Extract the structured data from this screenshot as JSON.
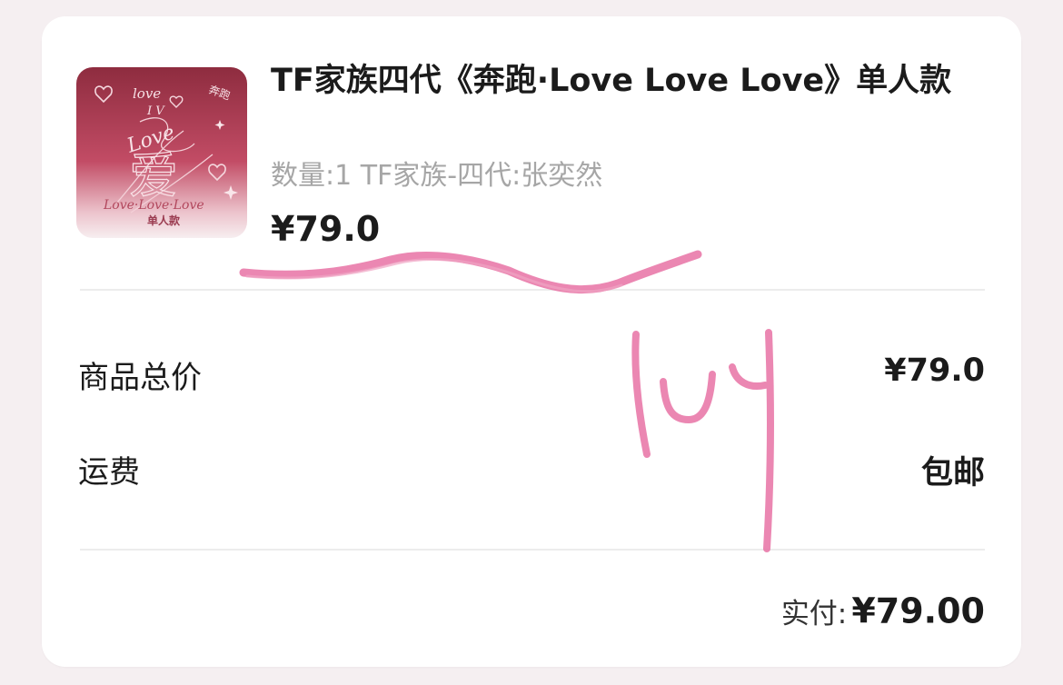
{
  "product": {
    "title": "TF家族四代《奔跑·Love Love Love》单人款",
    "spec": "数量:1 TF家族-四代:张奕然",
    "price": "¥79.0",
    "thumbnail": {
      "top_text": "love",
      "mid_text": "I V",
      "script_text": "Love",
      "big_char": "爱",
      "corner_text": "奔跑",
      "line_text": "Love·Love·Love",
      "edition_text": "单人款",
      "colors": {
        "dark": "#8e2c3f",
        "mid": "#c24c65",
        "light": "#f1dbe0"
      }
    }
  },
  "summary": {
    "subtotal_label": "商品总价",
    "subtotal_value": "¥79.0",
    "shipping_label": "运费",
    "shipping_value": "包邮"
  },
  "footer": {
    "paid_label": "实付:",
    "paid_value": "¥79.00"
  },
  "annotation": {
    "handwritten_text": "IUY",
    "color": "#e872a4"
  }
}
